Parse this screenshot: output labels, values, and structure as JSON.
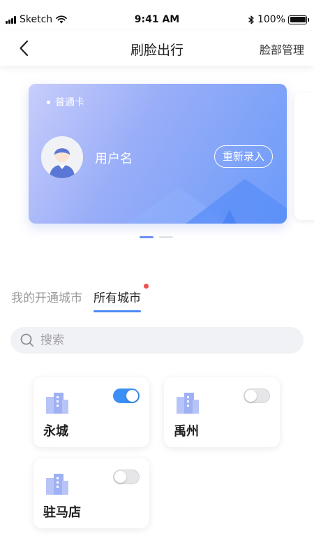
{
  "status_bar": {
    "carrier": "Sketch",
    "time": "9:41 AM",
    "battery": "100%"
  },
  "nav": {
    "title": "刷脸出行",
    "right_action": "脸部管理",
    "back_icon": "chevron-left-icon"
  },
  "card": {
    "type_label": "普通卡",
    "username": "用户名",
    "rerecord_label": "重新录入",
    "carousel_active_index": 0,
    "carousel_count": 2
  },
  "tabs": [
    {
      "label": "我的开通城市",
      "active": false
    },
    {
      "label": "所有城市",
      "active": true,
      "badge": "red-dot"
    }
  ],
  "search": {
    "placeholder": "搜索",
    "value": ""
  },
  "cities": [
    {
      "name": "永城",
      "enabled": true
    },
    {
      "name": "禹州",
      "enabled": false
    },
    {
      "name": "驻马店",
      "enabled": false
    }
  ],
  "colors": {
    "accent": "#4c8df6",
    "toggle_on": "#3b8ff6",
    "badge": "#f24e4e",
    "card_gradient_start": "#c8cdfb",
    "card_gradient_end": "#6b9bf9",
    "city_icon": "#9fb1f4"
  }
}
